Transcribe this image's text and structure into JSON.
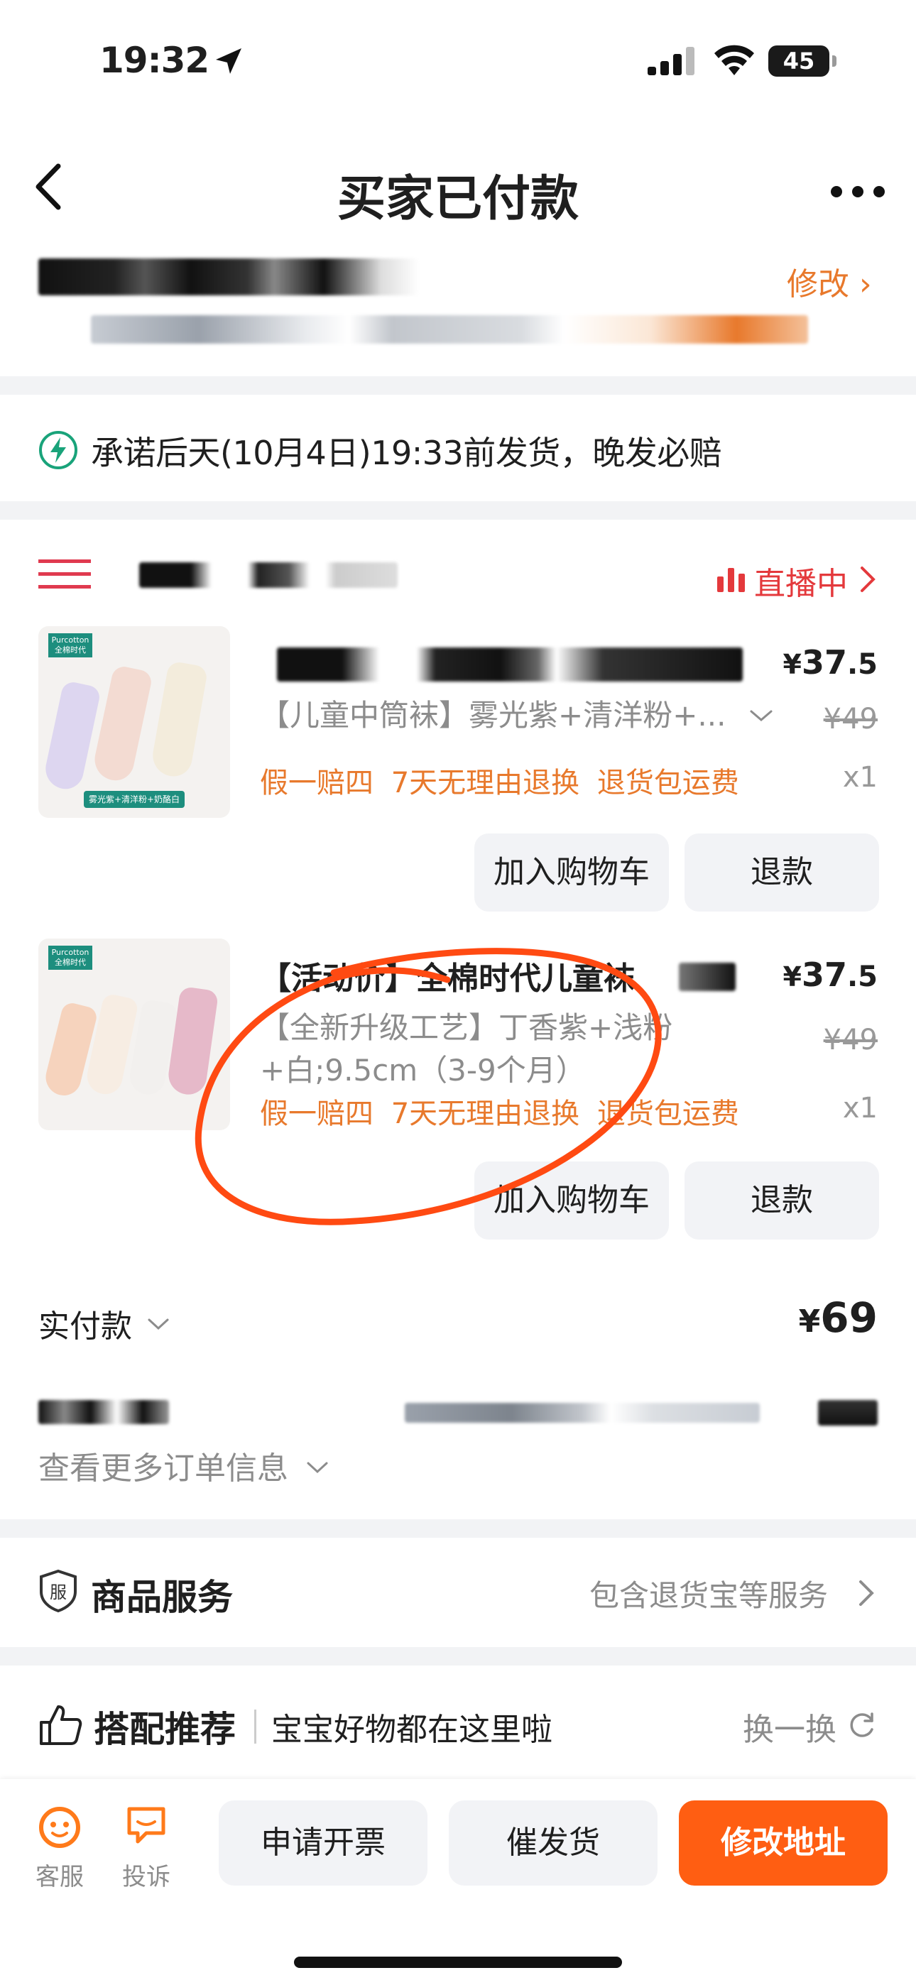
{
  "status_bar": {
    "time": "19:32",
    "battery": "45"
  },
  "nav": {
    "title": "买家已付款"
  },
  "address": {
    "edit_label": "修改 ›"
  },
  "promise": {
    "text": "承诺后天(10月4日)19:33前发货，晚发必赔"
  },
  "shop": {
    "live_label": "直播中"
  },
  "products": [
    {
      "title": "",
      "sku": "【儿童中筒袜】雾光紫+清洋粉+...",
      "price_symbol": "¥",
      "price_int": "37",
      "price_dec": ".5",
      "original_price": "¥49",
      "tags": "假一赔四 7天无理由退换 退货包运费",
      "qty": "x1",
      "image_label": "雾光紫+清洋粉+奶酪白",
      "brand": "Purcotton 全棉时代"
    },
    {
      "title": "【活动价】全棉时代儿童袜",
      "sku": "【全新升级工艺】丁香紫+浅粉+白;9.5cm（3-9个月）",
      "price_symbol": "¥",
      "price_int": "37",
      "price_dec": ".5",
      "original_price": "¥49",
      "tags": "假一赔四 7天无理由退换 退货包运费",
      "qty": "x1",
      "brand": "Purcotton 全棉时代"
    }
  ],
  "actions": {
    "add_cart": "加入购物车",
    "refund": "退款"
  },
  "paid": {
    "label": "实付款",
    "symbol": "¥",
    "amount": "69"
  },
  "more_info": "查看更多订单信息",
  "service": {
    "title": "商品服务",
    "desc": "包含退货宝等服务",
    "icon_char": "服"
  },
  "recommend": {
    "title": "搭配推荐",
    "subtitle": "宝宝好物都在这里啦",
    "refresh": "换一换"
  },
  "bottom": {
    "service_label": "客服",
    "complain_label": "投诉",
    "invoice": "申请开票",
    "urge": "催发货",
    "change_address": "修改地址"
  },
  "colors": {
    "accent_orange": "#ff5e12",
    "tag_orange": "#e8792c",
    "live_red": "#e4393c",
    "promise_green": "#19a37a",
    "annotation": "#ff4a12"
  }
}
